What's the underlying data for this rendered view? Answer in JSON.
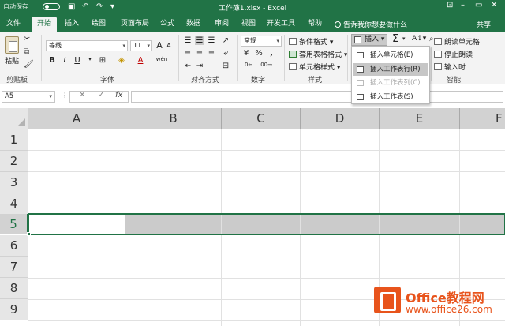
{
  "titlebar": {
    "autosave": "自动保存",
    "toggle_state": "关",
    "title": "工作簿1.xlsx - Excel",
    "share": "共享"
  },
  "tabs": [
    "文件",
    "开始",
    "插入",
    "绘图",
    "页面布局",
    "公式",
    "数据",
    "审阅",
    "视图",
    "开发工具",
    "帮助"
  ],
  "active_tab": "开始",
  "tellme": "告诉我你想要做什么",
  "ribbon": {
    "clipboard": {
      "paste": "粘贴",
      "group": "剪贴板"
    },
    "font": {
      "name": "等线",
      "size": "11",
      "bold": "B",
      "italic": "I",
      "underline": "U",
      "grow": "A",
      "shrink": "A",
      "wen": "wén",
      "color_a": "A",
      "group": "字体"
    },
    "align": {
      "group": "对齐方式"
    },
    "number": {
      "format": "常规",
      "percent": "%",
      "comma": ",",
      "group": "数字"
    },
    "styles": {
      "cond": "条件格式",
      "table": "套用表格格式",
      "cell": "单元格样式",
      "group": "样式"
    },
    "cells": {
      "insert": "插入"
    },
    "ai": {
      "read_cell": "朗读单元格",
      "stop_read": "停止朗读",
      "enter_read": "输入时",
      "group": "智能"
    },
    "insert_menu": [
      {
        "label": "插入单元格(E)",
        "state": "normal"
      },
      {
        "label": "插入工作表行(R)",
        "state": "hover"
      },
      {
        "label": "插入工作表列(C)",
        "state": "disabled"
      },
      {
        "label": "插入工作表(S)",
        "state": "normal"
      }
    ]
  },
  "formula_bar": {
    "name_box": "A5",
    "cancel": "✕",
    "enter": "✓",
    "fx": "fx",
    "formula": ""
  },
  "grid": {
    "columns": [
      "A",
      "B",
      "C",
      "D",
      "E",
      "F"
    ],
    "rows": [
      "1",
      "2",
      "3",
      "4",
      "5",
      "6",
      "7",
      "8",
      "9"
    ],
    "selected_row": "5",
    "active_cell": "A5"
  },
  "watermark": {
    "brand": "Office教程网",
    "url": "www.office26.com"
  },
  "colors": {
    "excel_green": "#217346",
    "selection_gray": "#cbcbcb",
    "watermark_orange": "#e8541c"
  }
}
